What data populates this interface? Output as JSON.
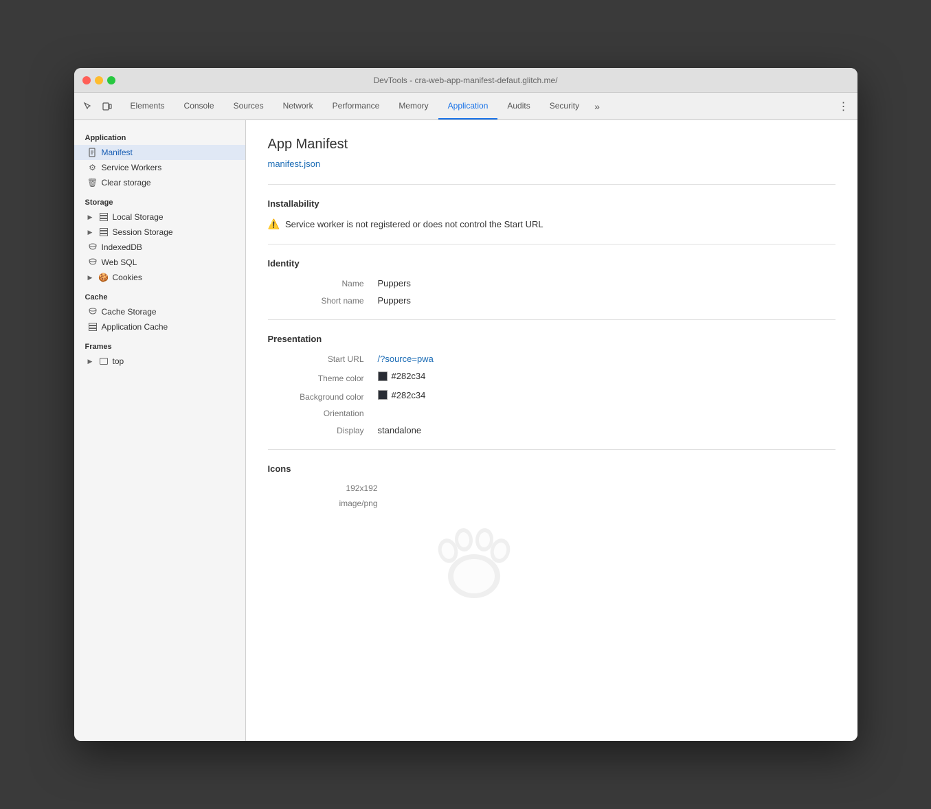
{
  "window": {
    "title": "DevTools - cra-web-app-manifest-defaut.glitch.me/"
  },
  "tabs": [
    {
      "id": "elements",
      "label": "Elements",
      "active": false
    },
    {
      "id": "console",
      "label": "Console",
      "active": false
    },
    {
      "id": "sources",
      "label": "Sources",
      "active": false
    },
    {
      "id": "network",
      "label": "Network",
      "active": false
    },
    {
      "id": "performance",
      "label": "Performance",
      "active": false
    },
    {
      "id": "memory",
      "label": "Memory",
      "active": false
    },
    {
      "id": "application",
      "label": "Application",
      "active": true
    },
    {
      "id": "audits",
      "label": "Audits",
      "active": false
    },
    {
      "id": "security",
      "label": "Security",
      "active": false
    }
  ],
  "sidebar": {
    "application_label": "Application",
    "manifest_item": "Manifest",
    "service_workers_item": "Service Workers",
    "clear_storage_item": "Clear storage",
    "storage_label": "Storage",
    "local_storage_item": "Local Storage",
    "session_storage_item": "Session Storage",
    "indexeddb_item": "IndexedDB",
    "web_sql_item": "Web SQL",
    "cookies_item": "Cookies",
    "cache_label": "Cache",
    "cache_storage_item": "Cache Storage",
    "application_cache_item": "Application Cache",
    "frames_label": "Frames",
    "frames_top_item": "top"
  },
  "content": {
    "page_title": "App Manifest",
    "manifest_link": "manifest.json",
    "installability_title": "Installability",
    "installability_warning": "Service worker is not registered or does not control the Start URL",
    "identity_title": "Identity",
    "name_label": "Name",
    "name_value": "Puppers",
    "short_name_label": "Short name",
    "short_name_value": "Puppers",
    "presentation_title": "Presentation",
    "start_url_label": "Start URL",
    "start_url_value": "/?source=pwa",
    "theme_color_label": "Theme color",
    "theme_color_value": "#282c34",
    "theme_color_hex": "#282c34",
    "background_color_label": "Background color",
    "background_color_value": "#282c34",
    "background_color_hex": "#282c34",
    "orientation_label": "Orientation",
    "orientation_value": "",
    "display_label": "Display",
    "display_value": "standalone",
    "icons_title": "Icons",
    "icon_size": "192x192",
    "icon_type": "image/png"
  }
}
